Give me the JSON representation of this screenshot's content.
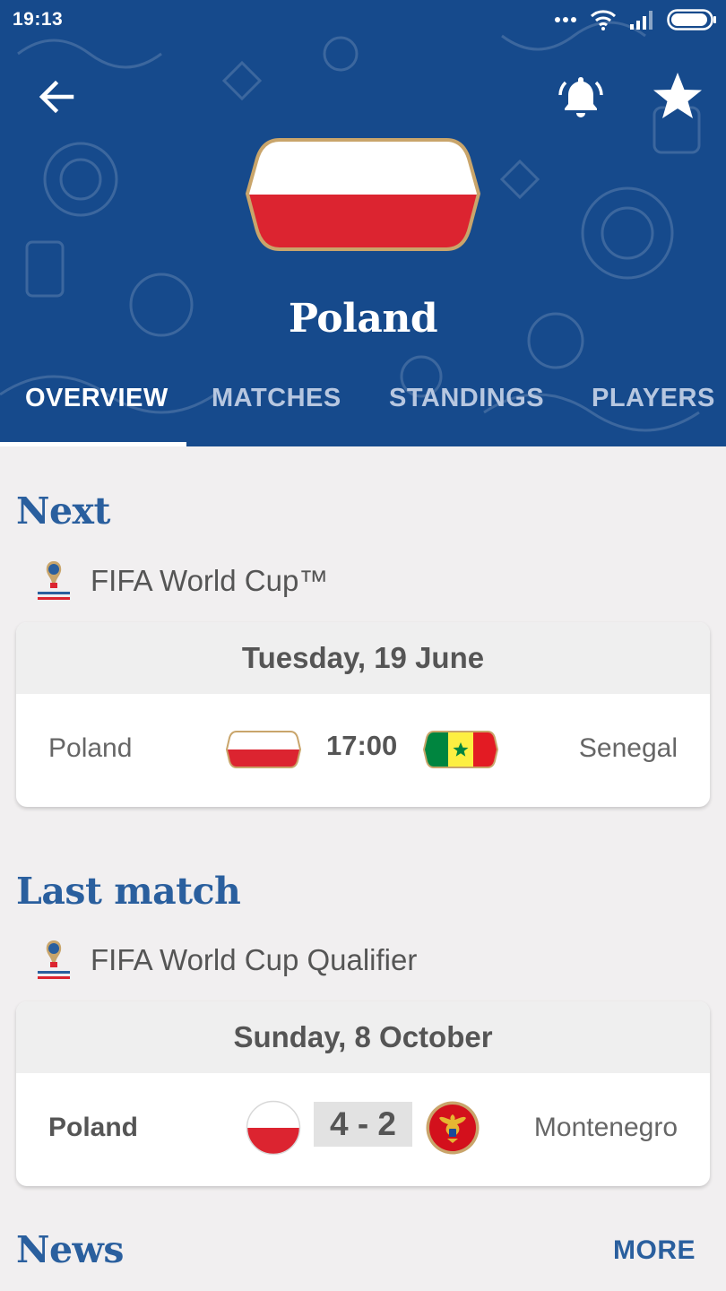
{
  "status_bar": {
    "time": "19:13",
    "icons": [
      "more-dots-icon",
      "wifi-icon",
      "signal-icon",
      "battery-icon"
    ]
  },
  "header": {
    "team_name": "Poland",
    "actions": [
      "back-arrow-icon",
      "notification-bell-icon",
      "favorite-star-icon"
    ]
  },
  "tabs": [
    {
      "label": "OVERVIEW",
      "active": true
    },
    {
      "label": "MATCHES",
      "active": false
    },
    {
      "label": "STANDINGS",
      "active": false
    },
    {
      "label": "PLAYERS",
      "active": false
    }
  ],
  "next": {
    "title": "Next",
    "competition": "FIFA World Cup™",
    "date": "Tuesday, 19 June",
    "home_team": "Poland",
    "time": "17:00",
    "away_team": "Senegal"
  },
  "last_match": {
    "title": "Last match",
    "competition": "FIFA World Cup Qualifier",
    "date": "Sunday, 8 October",
    "home_team": "Poland",
    "score": "4 - 2",
    "away_team": "Montenegro"
  },
  "news": {
    "title": "News",
    "more_label": "MORE"
  },
  "colors": {
    "header_blue": "#164a8c",
    "title_blue": "#2a5f9e",
    "poland_red": "#dc2430",
    "flag_gold": "#c9a56b",
    "senegal_green": "#00853f",
    "senegal_yellow": "#fdef42"
  }
}
